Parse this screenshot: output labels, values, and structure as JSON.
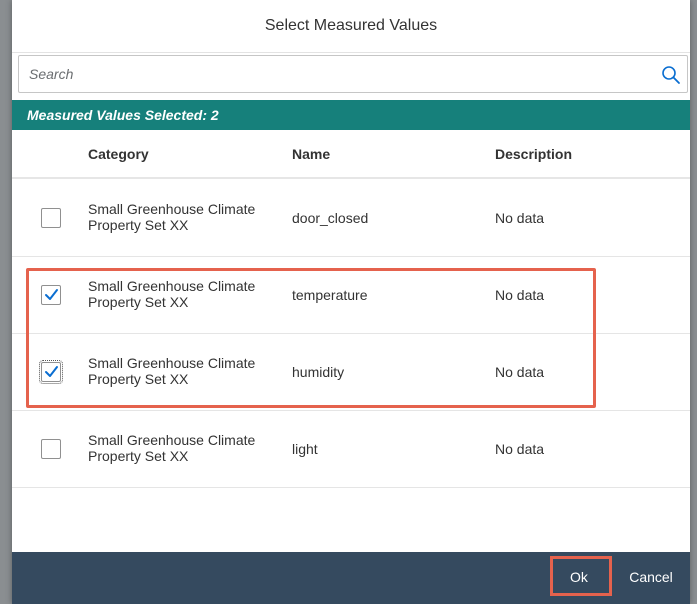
{
  "dialog": {
    "title": "Select Measured Values"
  },
  "search": {
    "placeholder": "Search",
    "value": ""
  },
  "selection": {
    "summary": "Measured Values Selected: 2"
  },
  "table": {
    "columns": [
      "Category",
      "Name",
      "Description"
    ],
    "rows": [
      {
        "category": "Small Greenhouse Climate Property Set XX",
        "name": "door_closed",
        "description": "No data",
        "checked": false
      },
      {
        "category": "Small Greenhouse Climate Property Set XX",
        "name": "temperature",
        "description": "No data",
        "checked": true
      },
      {
        "category": "Small Greenhouse Climate Property Set XX",
        "name": "humidity",
        "description": "No data",
        "checked": true
      },
      {
        "category": "Small Greenhouse Climate Property Set XX",
        "name": "light",
        "description": "No data",
        "checked": false
      }
    ]
  },
  "footer": {
    "ok_label": "Ok",
    "cancel_label": "Cancel"
  },
  "colors": {
    "selected_bar": "#16807b",
    "footer": "#354a5f",
    "highlight": "#e5624d",
    "checkmark": "#0a6ed1"
  }
}
